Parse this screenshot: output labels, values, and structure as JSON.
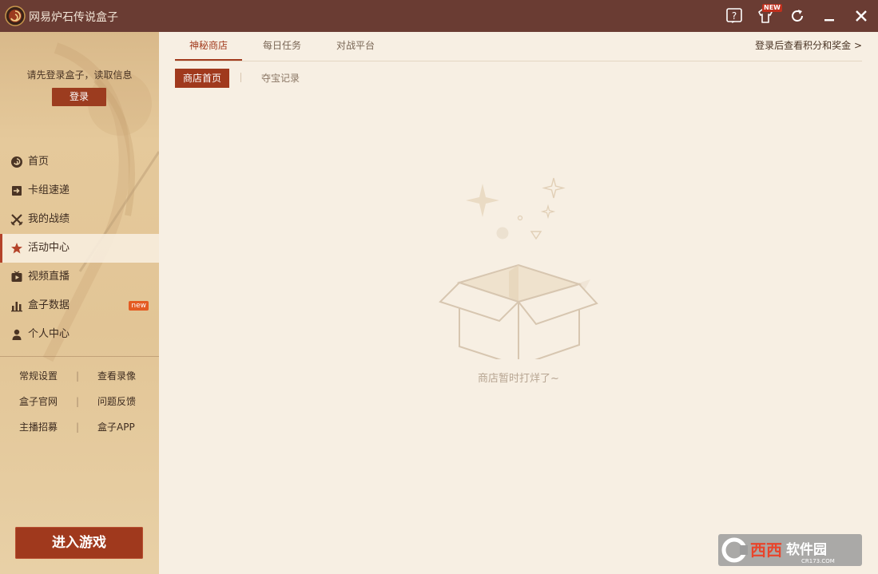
{
  "app": {
    "title": "网易炉石传说盒子"
  },
  "titlebar": {
    "new_tag": "NEW"
  },
  "sidebar": {
    "login_tip": "请先登录盒子，读取信息",
    "login_label": "登录",
    "nav": [
      {
        "label": "首页",
        "icon": "swirl-icon"
      },
      {
        "label": "卡组速递",
        "icon": "deck-export-icon"
      },
      {
        "label": "我的战绩",
        "icon": "crossed-swords-icon"
      },
      {
        "label": "活动中心",
        "icon": "star-icon",
        "active": true
      },
      {
        "label": "视频直播",
        "icon": "video-icon"
      },
      {
        "label": "盒子数据",
        "icon": "bar-chart-icon",
        "badge": "new"
      },
      {
        "label": "个人中心",
        "icon": "person-icon"
      }
    ],
    "links": [
      {
        "left": "常规设置",
        "right": "查看录像"
      },
      {
        "left": "盒子官网",
        "right": "问题反馈"
      },
      {
        "left": "主播招募",
        "right": "盒子APP"
      }
    ],
    "separator": "|",
    "enter_game_label": "进入游戏"
  },
  "main": {
    "tabs": [
      "神秘商店",
      "每日任务",
      "对战平台"
    ],
    "active_tab": 0,
    "login_link": "登录后查看积分和奖金 >",
    "subtabs": {
      "active": "商店首页",
      "other": "夺宝记录"
    },
    "empty_text": "商店暂时打烊了~"
  },
  "watermark": {
    "text": "西西软件园",
    "sub": "CR173.COM"
  },
  "colors": {
    "titlebar": "#6a3c33",
    "accent": "#a0391d",
    "background": "#f7efe3"
  }
}
